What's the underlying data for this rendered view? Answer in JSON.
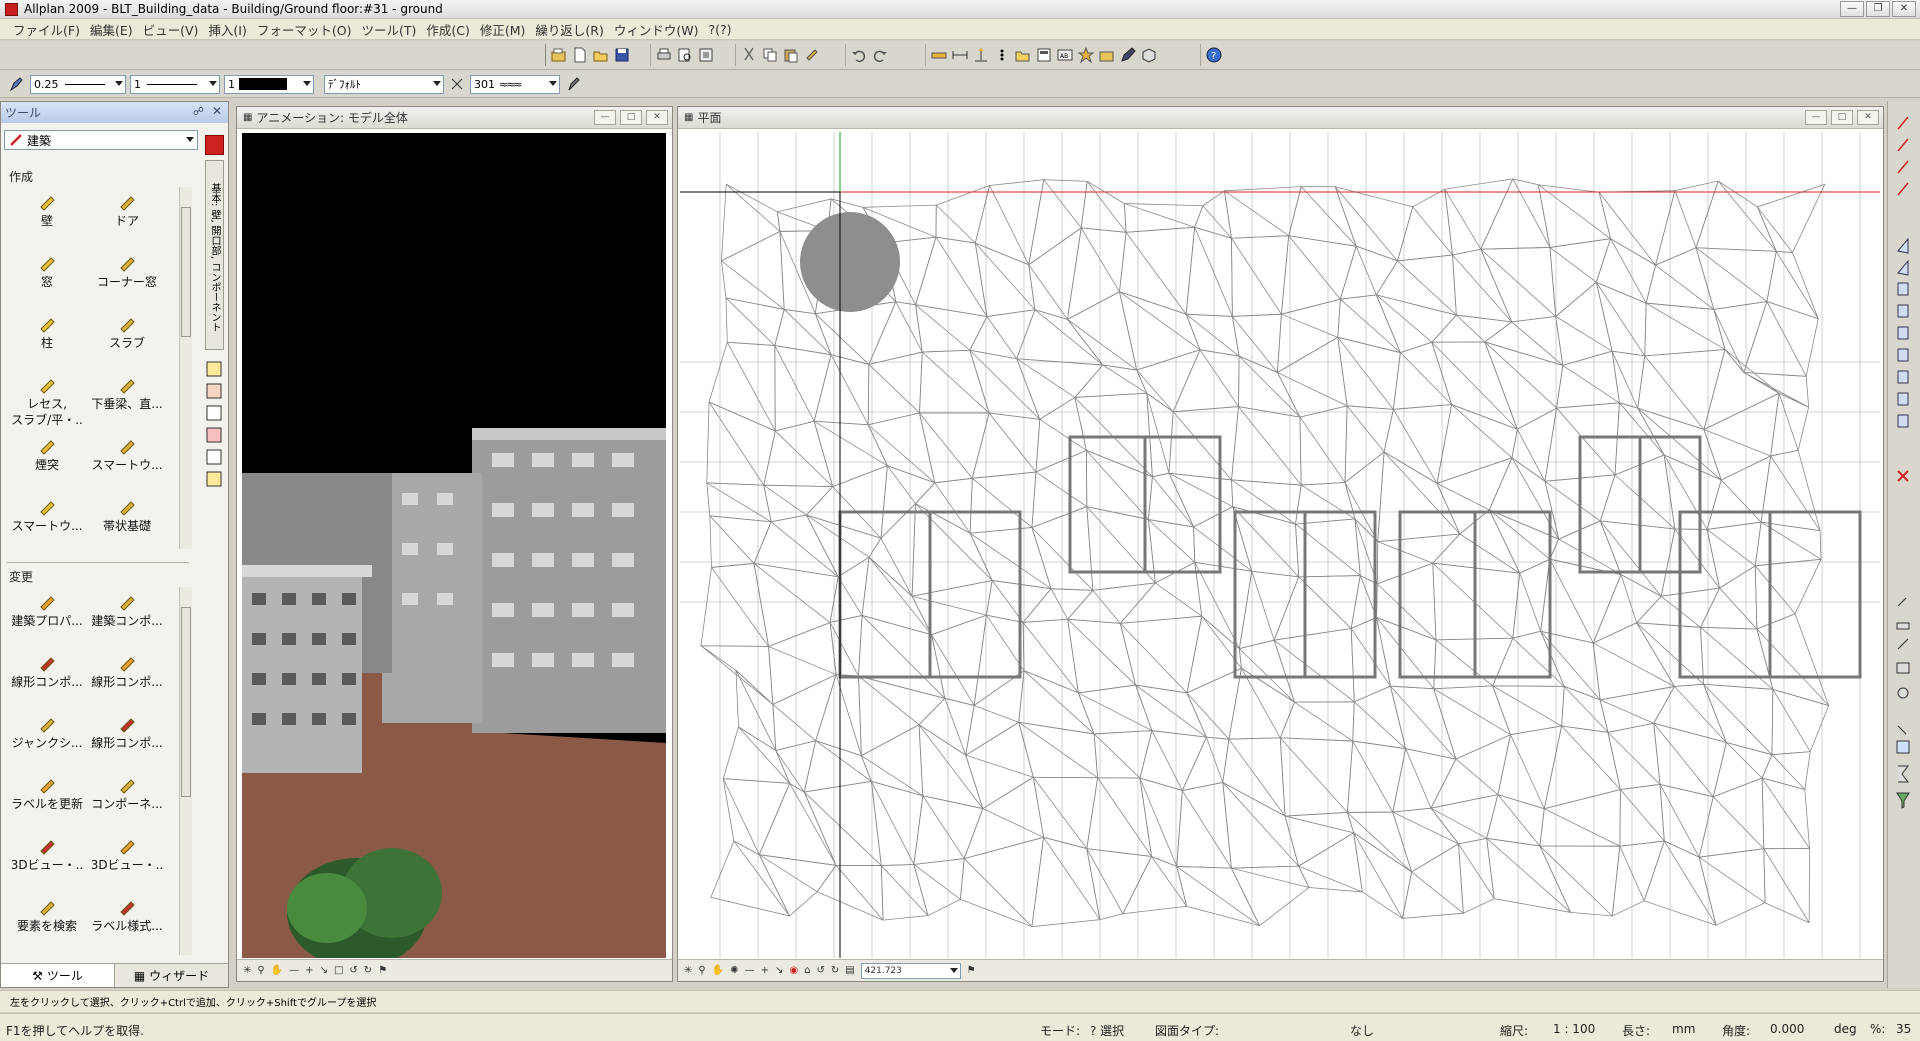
{
  "window": {
    "title": "Allplan 2009 - BLT_Building_data - Building/Ground floor:#31 - ground"
  },
  "menu": [
    "ファイル(F)",
    "編集(E)",
    "ビュー(V)",
    "挿入(I)",
    "フォーマット(O)",
    "ツール(T)",
    "作成(C)",
    "修正(M)",
    "繰り返し(R)",
    "ウィンドウ(W)",
    "?(?)"
  ],
  "format_bar": {
    "pen": "0.25",
    "line": "1",
    "color": "1",
    "layer": "ﾃﾞﾌｫﾙﾄ",
    "hatch": "301"
  },
  "tools_panel": {
    "title": "ツール",
    "module": "建築",
    "section_create": "作成",
    "create_tools": [
      "壁",
      "ドア",
      "窓",
      "コーナー窓",
      "柱",
      "スラブ",
      "レセス,\nスラブ/平・..",
      "下垂梁、直...",
      "煙突",
      "スマートウ...",
      "スマートウ...",
      "帯状基礎"
    ],
    "section_modify": "変更",
    "modify_tools": [
      "建築プロパ...",
      "建築コンポ...",
      "線形コンポ...",
      "線形コンポ...",
      "ジャンクシ...",
      "線形コンポ...",
      "ラベルを更新",
      "コンポーネ...",
      "3Dビュー・..",
      "3Dビュー・..",
      "要素を検索",
      "ラベル様式..."
    ],
    "side_tab_label": "基本: 壁, 開口部, コンポーネント",
    "tab_tools": "ツール",
    "tab_wizard": "ウィザード"
  },
  "anim_window": {
    "title": "アニメーション: モデル全体"
  },
  "plan_window": {
    "title": "平面",
    "scale_value": "421.723"
  },
  "status": {
    "hint": "左をクリックして選択、クリック+Ctrlで追加、クリック+Shiftでグループを選択",
    "help": "F1を押してヘルプを取得.",
    "mode_label": "モード:",
    "mode_value": "? 選択",
    "drawing_type_label": "図面タイプ:",
    "drawing_type_value": "なし",
    "scale_label": "縮尺:",
    "scale_value": "1 : 100",
    "length_label": "長さ:",
    "length_value": "mm",
    "angle_label": "角度:",
    "angle_value": "0.000",
    "angle_unit": "deg",
    "percent_label": "%:",
    "percent_value": "35"
  },
  "colors": {
    "accent_red": "#cc1f1f",
    "ground": "#8a5a47",
    "sky": "#000000",
    "grid_line": "#7a7a7a"
  }
}
